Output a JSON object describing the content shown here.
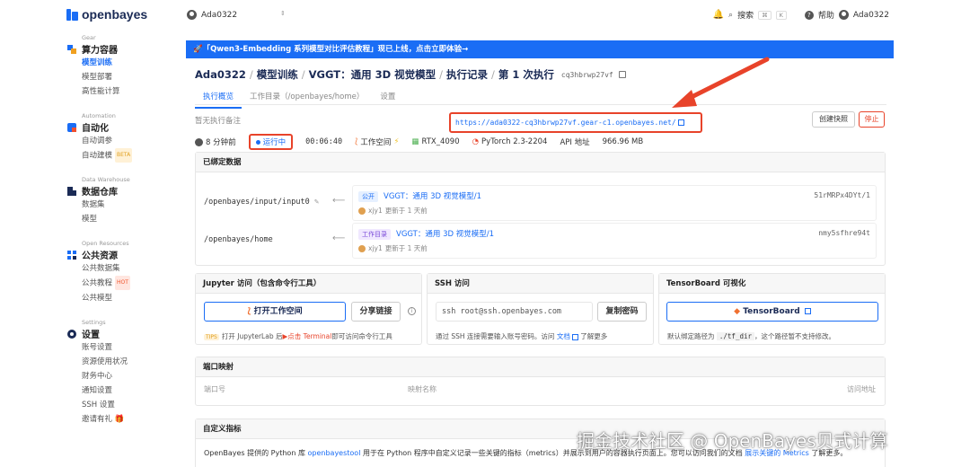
{
  "brand": {
    "name": "openbayes",
    "color": "#1a6df5"
  },
  "sidebar": {
    "sections": [
      {
        "en": "Gear",
        "title": "算力容器",
        "items": [
          "模型训练",
          "模型部署",
          "高性能计算"
        ]
      },
      {
        "en": "Automation",
        "title": "自动化",
        "items": [
          "自动调参",
          "自动建模"
        ],
        "badge": "BETA"
      },
      {
        "en": "Data Warehouse",
        "title": "数据仓库",
        "items": [
          "数据集",
          "模型"
        ]
      },
      {
        "en": "Open Resources",
        "title": "公共资源",
        "items": [
          "公共数据集",
          "公共教程",
          "公共模型"
        ],
        "badge": "HOT"
      },
      {
        "en": "Settings",
        "title": "设置",
        "items": [
          "账号设置",
          "资源使用状况",
          "财务中心",
          "通知设置",
          "SSH 设置",
          "邀请有礼"
        ]
      }
    ]
  },
  "topbar": {
    "user": "Ada0322",
    "search": "搜索",
    "kbd1": "⌘",
    "kbd2": "K",
    "help": "帮助",
    "account": "Ada0322"
  },
  "banner": {
    "text": "🚀「Qwen3-Embedding 系列模型对比评估教程」现已上线，点击立即体验→"
  },
  "breadcrumb": {
    "p1": "Ada0322",
    "p2": "模型训练",
    "p3": "VGGT：通用 3D 视觉模型",
    "p4": "执行记录",
    "p5": "第 1 次执行",
    "hash": "cq3hbrwp27vf"
  },
  "tabs": [
    "执行概览",
    "工作目录（/openbayes/home）",
    "设置"
  ],
  "note": "暂无执行备注",
  "url": "https://ada0322-cq3hbrwp27vf.gear-c1.openbayes.net/",
  "actions": {
    "snapshot": "创建快照",
    "stop": "停止"
  },
  "status": {
    "time_ago": "8 分钟前",
    "state": "运行中",
    "duration": "00:06:40",
    "workspace": "工作空间",
    "gpu": "RTX_4090",
    "framework": "PyTorch 2.3-2204",
    "api": "API 地址",
    "size": "966.96 MB"
  },
  "bound": {
    "title": "已绑定数据",
    "rows": [
      {
        "path": "/openbayes/input/input0",
        "tag": "公开",
        "name": "VGGT：通用 3D 视觉模型/1",
        "user": "xjy1",
        "updated": "更新于 1 天前",
        "hash": "51rMRPx4DYt/1"
      },
      {
        "path": "/openbayes/home",
        "tag": "工作目录",
        "name": "VGGT：通用 3D 视觉模型/1",
        "user": "xjy1",
        "updated": "更新于 1 天前",
        "hash": "nmy5sfhre94t"
      }
    ]
  },
  "jupyter": {
    "title": "Jupyter 访问（包含命令行工具）",
    "open": "打开工作空间",
    "share": "分享链接",
    "tips": "TIPS",
    "tip_a": "打开 JupyterLab 后",
    "tip_b": "点击 Terminal",
    "tip_c": "即可访问命令行工具"
  },
  "ssh": {
    "title": "SSH 访问",
    "cmd": "ssh root@ssh.openbayes.com",
    "copy": "复制密码",
    "tip_a": "通过 SSH 连接需要输入账号密码。访问",
    "tip_link": "文档",
    "tip_b": "了解更多"
  },
  "tensorboard": {
    "title": "TensorBoard 可视化",
    "button": "TensorBoard",
    "tip_a": "默认绑定路径为",
    "tip_code": "./tf_dir",
    "tip_b": "，这个路径暂不支持修改。"
  },
  "ports": {
    "title": "端口映射",
    "col1": "端口号",
    "col2": "映射名称",
    "col3": "访问地址"
  },
  "metrics": {
    "title": "自定义指标",
    "text_a": "OpenBayes 提供的 Python 库",
    "lib": "openbayestool",
    "text_b": "用于在 Python 程序中自定义记录一些关键的指标（metrics）并展示到用户的容器执行页面上。您可以访问我们的文档",
    "link": "展示关键的 Metrics",
    "text_c": "了解更多。"
  },
  "watermark": "掘金技术社区 @ OpenBayes贝式计算"
}
